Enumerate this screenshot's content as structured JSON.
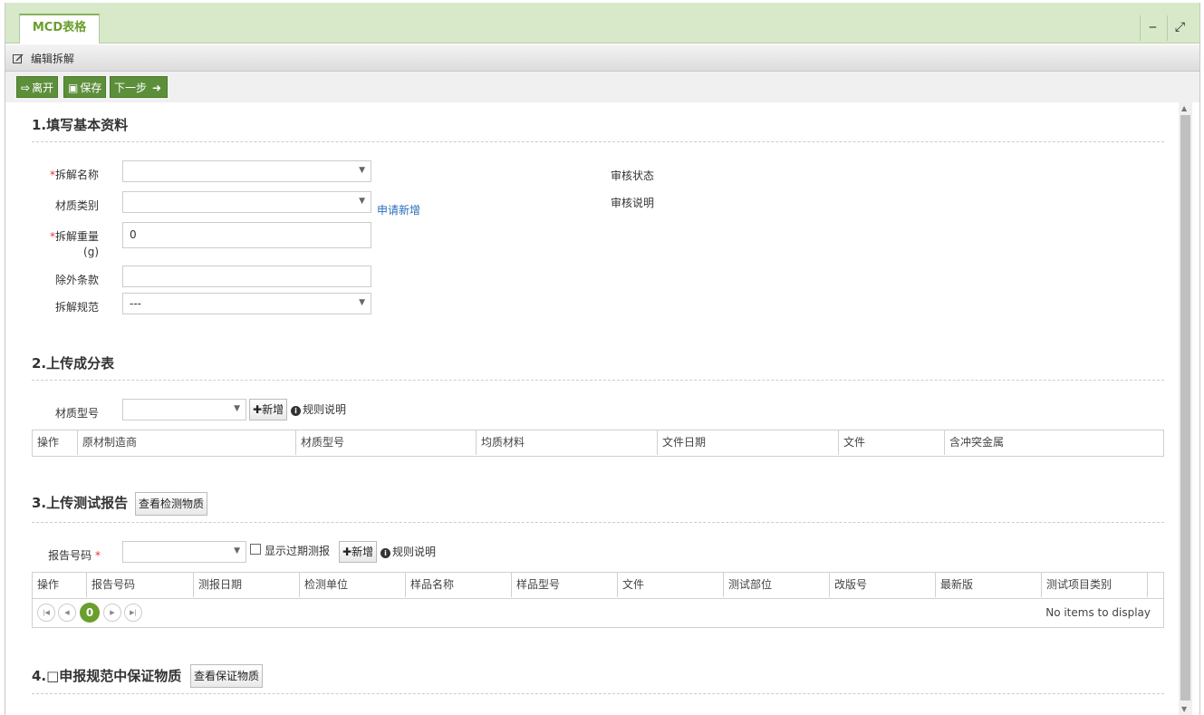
{
  "window": {
    "tab_label": "MCD表格",
    "minimize_label": "‒",
    "maximize_label": "⤢"
  },
  "subbar": {
    "label": "编辑拆解"
  },
  "toolbar": {
    "leave_label": "离开",
    "save_label": "保存",
    "next_label": "下一步"
  },
  "section1": {
    "title": "1.填写基本资料",
    "disassembly_name_label": "拆解名称",
    "material_category_label": "材质类别",
    "apply_new_link": "申请新增",
    "weight_label": "拆解重量",
    "weight_unit": "(g)",
    "weight_value": "0",
    "exclusion_label": "除外条款",
    "spec_label": "拆解规范",
    "spec_value": "---",
    "audit_status_label": "审核状态",
    "audit_desc_label": "审核说明"
  },
  "section2": {
    "title": "2.上传成分表",
    "material_model_label": "材质型号",
    "add_button": "新增",
    "rules_label": "规则说明",
    "columns": [
      "操作",
      "原材制造商",
      "材质型号",
      "均质材料",
      "文件日期",
      "文件",
      "含冲突金属"
    ]
  },
  "section3": {
    "title": "3.上传测试报告",
    "view_button": "查看检测物质",
    "report_no_label": "报告号码",
    "show_expired_label": "显示过期测报",
    "add_button": "新增",
    "rules_label": "规则说明",
    "columns": [
      "操作",
      "报告号码",
      "测报日期",
      "检测单位",
      "样品名称",
      "样品型号",
      "文件",
      "测试部位",
      "改版号",
      "最新版",
      "测试项目类别"
    ],
    "page_number": "0",
    "empty_text": "No items to display"
  },
  "section4": {
    "title": "4.□申报规范中保证物质",
    "view_button": "查看保证物质"
  }
}
